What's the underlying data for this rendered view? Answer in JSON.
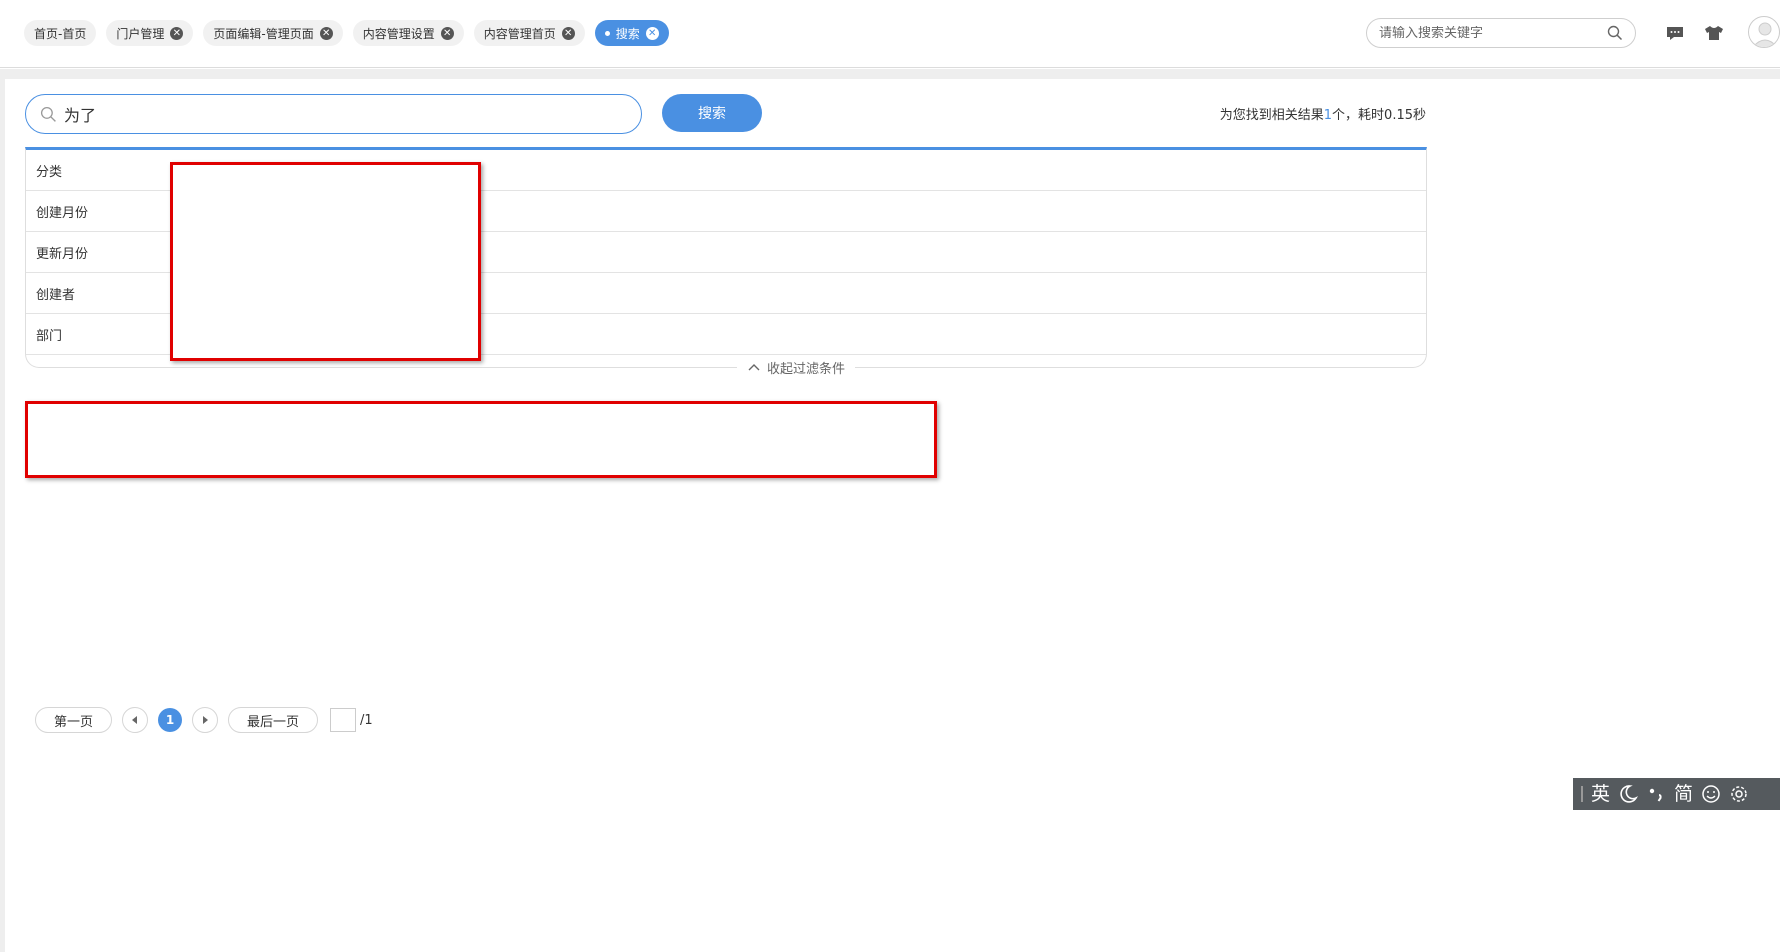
{
  "tabs": [
    {
      "label": "首页-首页",
      "closable": false,
      "active": false
    },
    {
      "label": "门户管理",
      "closable": true,
      "active": false
    },
    {
      "label": "页面编辑-管理页面",
      "closable": true,
      "active": false
    },
    {
      "label": "内容管理设置",
      "closable": true,
      "active": false
    },
    {
      "label": "内容管理首页",
      "closable": true,
      "active": false
    },
    {
      "label": "搜索",
      "closable": true,
      "active": true
    }
  ],
  "header": {
    "search_placeholder": "请输入搜索关键字",
    "icons": [
      "chat-icon",
      "shirt-icon",
      "avatar-icon"
    ]
  },
  "search": {
    "query": "为了",
    "button_label": "搜索",
    "result_prefix": "为您找到相关结果",
    "result_count": "1",
    "result_suffix": "个，耗时0.15秒"
  },
  "filters": {
    "rows": [
      "分类",
      "创建月份",
      "更新月份",
      "创建者",
      "部门"
    ],
    "collapse_label": "收起过滤条件"
  },
  "pagination": {
    "first_label": "第一页",
    "current_page": "1",
    "last_label": "最后一页",
    "total": "/1"
  },
  "ime_toolbar": {
    "lang": "英",
    "simplified": "简",
    "icons": [
      "moon-icon",
      "punctuation-icon",
      "smiley-icon",
      "gear-icon"
    ]
  },
  "colors": {
    "accent": "#4a90e2",
    "redaction_border": "#e00000",
    "ime_bg": "#555a5e"
  }
}
